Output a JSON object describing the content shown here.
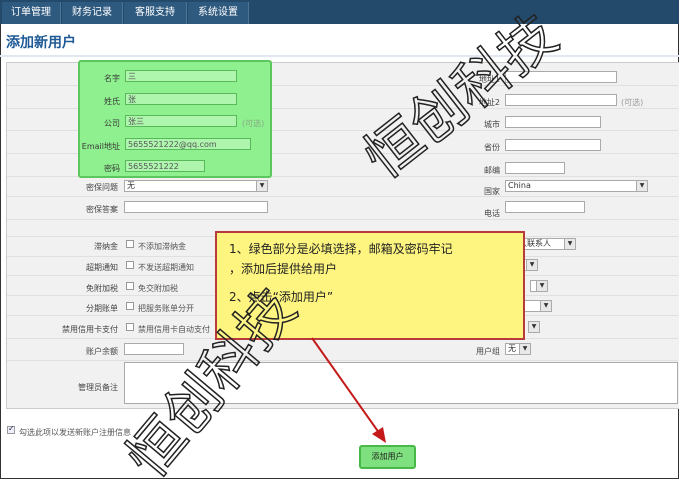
{
  "nav": {
    "tabs": [
      "订单管理",
      "财务记录",
      "客服支持",
      "系统设置"
    ]
  },
  "page_title": "添加新用户",
  "required": {
    "first_name": {
      "label": "名字",
      "value": "三"
    },
    "last_name": {
      "label": "姓氏",
      "value": "张"
    },
    "company": {
      "label": "公司",
      "value": "张三",
      "hint": "(可选)"
    },
    "email": {
      "label": "Email地址",
      "value": "5655521222@qq.com"
    },
    "password": {
      "label": "密码",
      "value": "5655521222"
    }
  },
  "security_question": {
    "label": "密保问题",
    "value": "无"
  },
  "security_answer": {
    "label": "密保答案",
    "value": ""
  },
  "right_fields": {
    "address1": {
      "label": "地址1",
      "value": ""
    },
    "address2": {
      "label": "地址2",
      "value": "",
      "hint": "(可选)"
    },
    "city": {
      "label": "城市",
      "value": ""
    },
    "province": {
      "label": "省份",
      "value": ""
    },
    "zip": {
      "label": "邮编",
      "value": ""
    },
    "country": {
      "label": "国家",
      "value": "China"
    },
    "phone": {
      "label": "电话",
      "value": ""
    }
  },
  "options": {
    "tax": {
      "label": "滞纳金",
      "text": "不添加滞纳金"
    },
    "overdue_notice": {
      "label": "超期通知",
      "text": "不发送超期通知"
    },
    "tax_exempt": {
      "label": "免附加税",
      "text": "免交附加税"
    },
    "split_invoice": {
      "label": "分期账单",
      "text": "把服务账单分开"
    },
    "disable_cc": {
      "label": "禁用信用卡支付",
      "text": "禁用信用卡自动支付"
    }
  },
  "balance": {
    "label": "账户余额",
    "value": ""
  },
  "admin_notes": {
    "label": "管理员备注"
  },
  "right_options": {
    "contact": {
      "value": "默认联系人"
    },
    "user_group": {
      "label": "用户组",
      "value": "无"
    }
  },
  "send_email": {
    "text": "勾选此项以发送新账户注册信息"
  },
  "add_button": "添加用户",
  "instructions": {
    "line1": "1、绿色部分是必填选择，邮箱及密码牢记",
    "line2": "，添加后提供给用户",
    "line3": "2、点击“添加用户”"
  },
  "watermark": {
    "text1": "恒创科技",
    "text2": "恒创科技"
  }
}
